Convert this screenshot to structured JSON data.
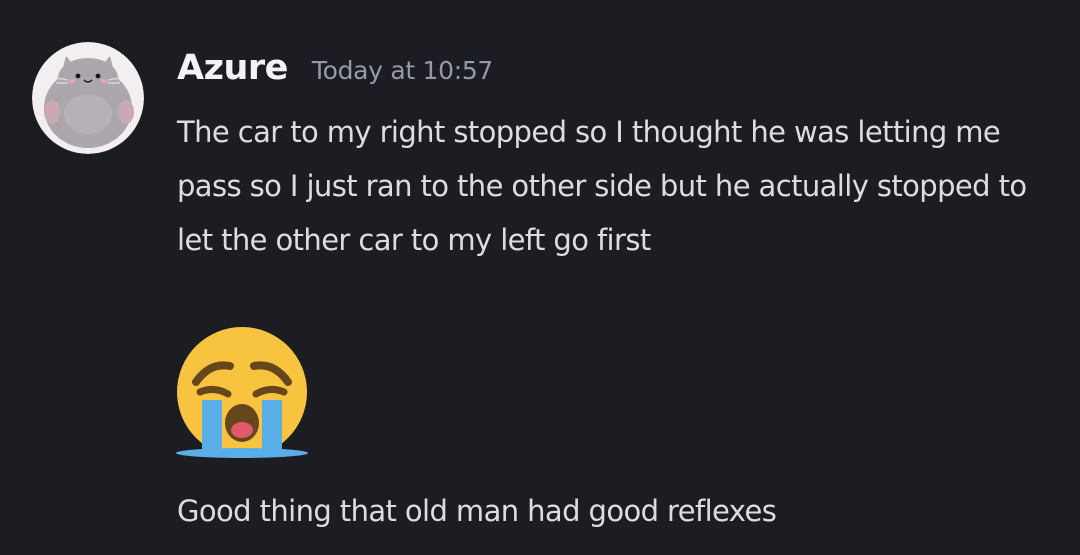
{
  "message": {
    "author": {
      "username": "Azure",
      "avatar_icon": "cat-avatar-icon"
    },
    "timestamp": "Today at 10:57",
    "content_text": "The car to my right stopped so I thought he was letting me pass so I just ran to the other side but he actually stopped to let the other car to my left go first",
    "emoji": {
      "icon": "loudly-crying-face-icon"
    },
    "followup_text": "Good thing that old man had good reflexes"
  },
  "colors": {
    "background": "#1c1d22",
    "username": "#f2f3f5",
    "timestamp": "#949ba4",
    "text": "#dbdee1",
    "emoji_face": "#f8c33e",
    "emoji_tears": "#5aaee8"
  }
}
